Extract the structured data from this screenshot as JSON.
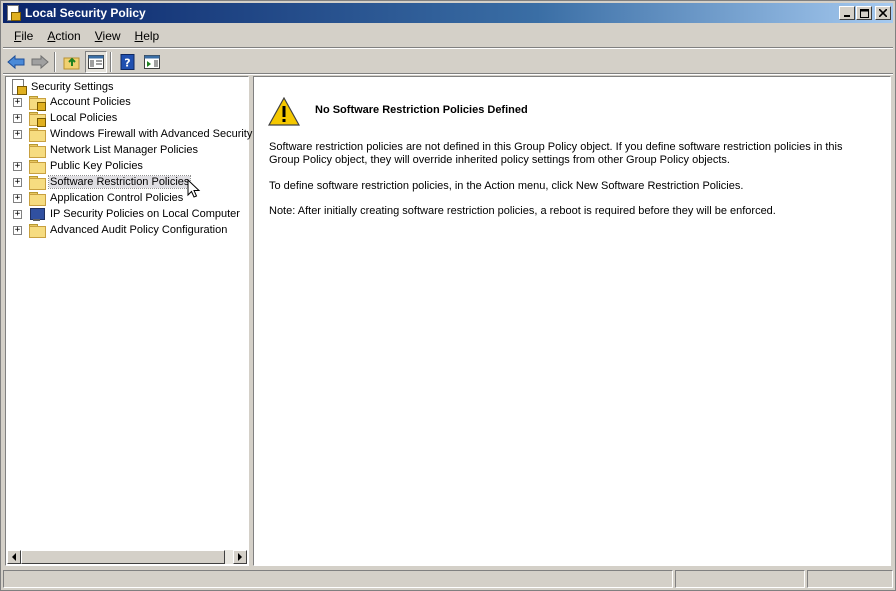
{
  "window": {
    "title": "Local Security Policy",
    "controls": {
      "minimize": "_",
      "maximize": "□",
      "close": "X"
    }
  },
  "menu": {
    "items": [
      {
        "label": "File",
        "accel": "F",
        "rest": "ile"
      },
      {
        "label": "Action",
        "accel": "A",
        "rest": "ction"
      },
      {
        "label": "View",
        "accel": "V",
        "rest": "iew"
      },
      {
        "label": "Help",
        "accel": "H",
        "rest": "elp"
      }
    ]
  },
  "toolbar": {
    "buttons": [
      "back-icon",
      "forward-icon",
      "up-folder-icon",
      "show-hide-console-tree-icon",
      "help-icon",
      "action-pane-icon"
    ]
  },
  "tree": {
    "root": "Security Settings",
    "items": [
      {
        "label": "Account Policies",
        "expandable": true,
        "icon": "locked-folder-icon"
      },
      {
        "label": "Local Policies",
        "expandable": true,
        "icon": "locked-folder-icon"
      },
      {
        "label": "Windows Firewall with Advanced Security",
        "expandable": true,
        "icon": "folder-icon"
      },
      {
        "label": "Network List Manager Policies",
        "expandable": false,
        "icon": "folder-icon"
      },
      {
        "label": "Public Key Policies",
        "expandable": true,
        "icon": "folder-icon"
      },
      {
        "label": "Software Restriction Policies",
        "expandable": true,
        "icon": "folder-icon",
        "selected": true
      },
      {
        "label": "Application Control Policies",
        "expandable": true,
        "icon": "folder-icon"
      },
      {
        "label": "IP Security Policies on Local Computer",
        "expandable": true,
        "icon": "monitor-icon"
      },
      {
        "label": "Advanced Audit Policy Configuration",
        "expandable": true,
        "icon": "folder-icon"
      }
    ]
  },
  "content": {
    "heading": "No Software Restriction Policies Defined",
    "para1_line1": "Software restriction policies are not defined in this Group Policy object. If you define software restriction policies in this",
    "para1_line2": "Group Policy object, they will override inherited policy settings from other Group Policy objects.",
    "para2": "To define software restriction policies, in the Action menu, click New Software Restriction Policies.",
    "para3": "Note: After initially creating software restriction policies, a reboot is required before they will be enforced."
  },
  "colors": {
    "titlebar_start": "#0a246a",
    "titlebar_end": "#a6caf0",
    "chrome": "#d4d0c8",
    "selection": "#e0dfe3"
  }
}
